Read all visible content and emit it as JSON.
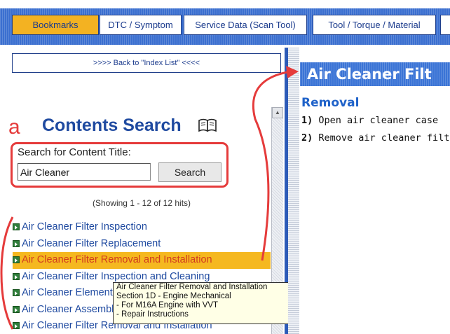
{
  "tabs": [
    {
      "label": "Bookmarks",
      "active": true
    },
    {
      "label": "DTC / Symptom",
      "active": false
    },
    {
      "label": "Service Data (Scan Tool)",
      "active": false
    },
    {
      "label": "Tool / Torque / Material",
      "active": false
    }
  ],
  "left_panel": {
    "back_link": ">>>> Back to \"Index List\" <<<<",
    "annotation_letter": "a",
    "title": "Contents Search",
    "title_icon": "book-icon",
    "search": {
      "label": "Search for Content Title:",
      "value": "Air Cleaner",
      "button_label": "Search"
    },
    "hits_text": "(Showing 1 - 12 of 12 hits)",
    "results": [
      "Air Cleaner Filter Inspection",
      "Air Cleaner Filter Replacement",
      "Air Cleaner Filter Removal and Installation",
      "Air Cleaner Filter Inspection and Cleaning",
      "Air Cleaner Element",
      "Air Cleaner Assembly",
      "Air Cleaner Filter Removal and Installation"
    ],
    "selected_index": 2
  },
  "tooltip": {
    "lines": [
      "Air Cleaner Filter Removal and Installation",
      "Section 1D - Engine Mechanical",
      "- For M16A Engine with VVT",
      "- Repair Instructions"
    ]
  },
  "document": {
    "title": "Air Cleaner Filt",
    "section": "Removal",
    "steps": [
      {
        "num": "1)",
        "text": "Open air cleaner case"
      },
      {
        "num": "2)",
        "text": "Remove air cleaner filt"
      }
    ]
  },
  "colors": {
    "tab_bar": "#3b6fd0",
    "active_tab": "#f3b222",
    "link": "#1f4aa0",
    "highlight_row": "#f5b820",
    "highlight_text": "#d23b1f",
    "annotation": "#e53b3b",
    "doc_title_bar": "#3b74d6",
    "doc_section": "#1f62c9"
  }
}
